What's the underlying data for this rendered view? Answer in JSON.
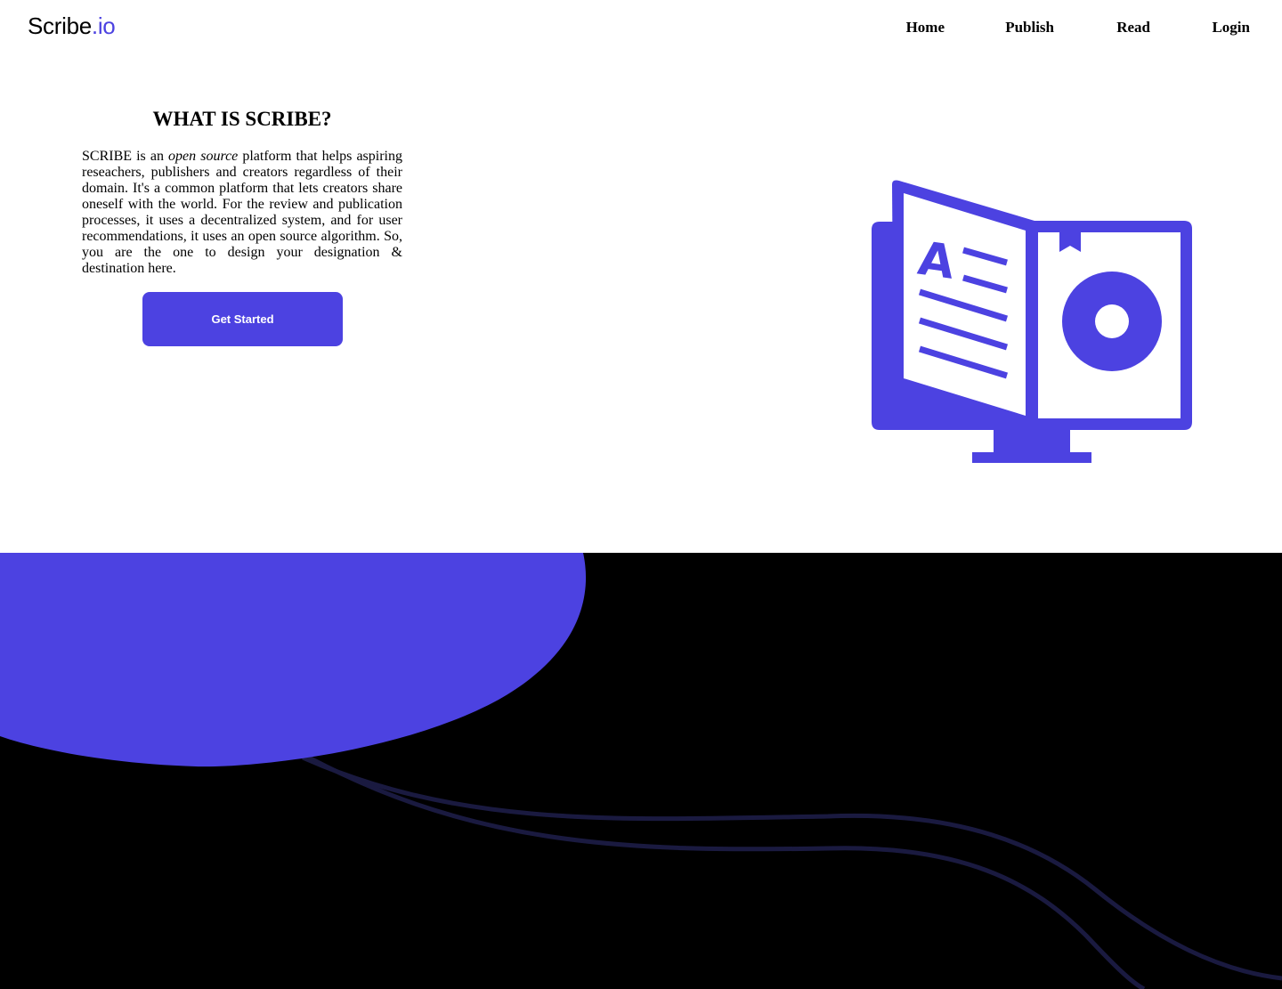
{
  "brand": {
    "name": "Scribe",
    "suffix": ".io",
    "accent_color": "#4c42e1"
  },
  "nav": {
    "items": [
      {
        "label": "Home"
      },
      {
        "label": "Publish"
      },
      {
        "label": "Read"
      },
      {
        "label": "Login"
      }
    ]
  },
  "hero": {
    "title": "WHAT IS SCRIBE?",
    "desc_before": "SCRIBE is an ",
    "desc_em": "open source",
    "desc_after": " platform that helps aspiring reseachers, publishers and creators regardless of their domain. It's a common platform that lets creators share oneself with the world. For the review and publication processes, it uses a decentralized system, and for user recommendations, it uses an open source algorithm. So, you are the one to design your designation & destination here.",
    "cta_label": "Get Started"
  },
  "illustration": {
    "icon": "book-monitor-icon",
    "letter": "A"
  },
  "footer": {
    "background": "#000000",
    "blob_color": "#4c42e1",
    "wave_color": "#1a1a40"
  }
}
